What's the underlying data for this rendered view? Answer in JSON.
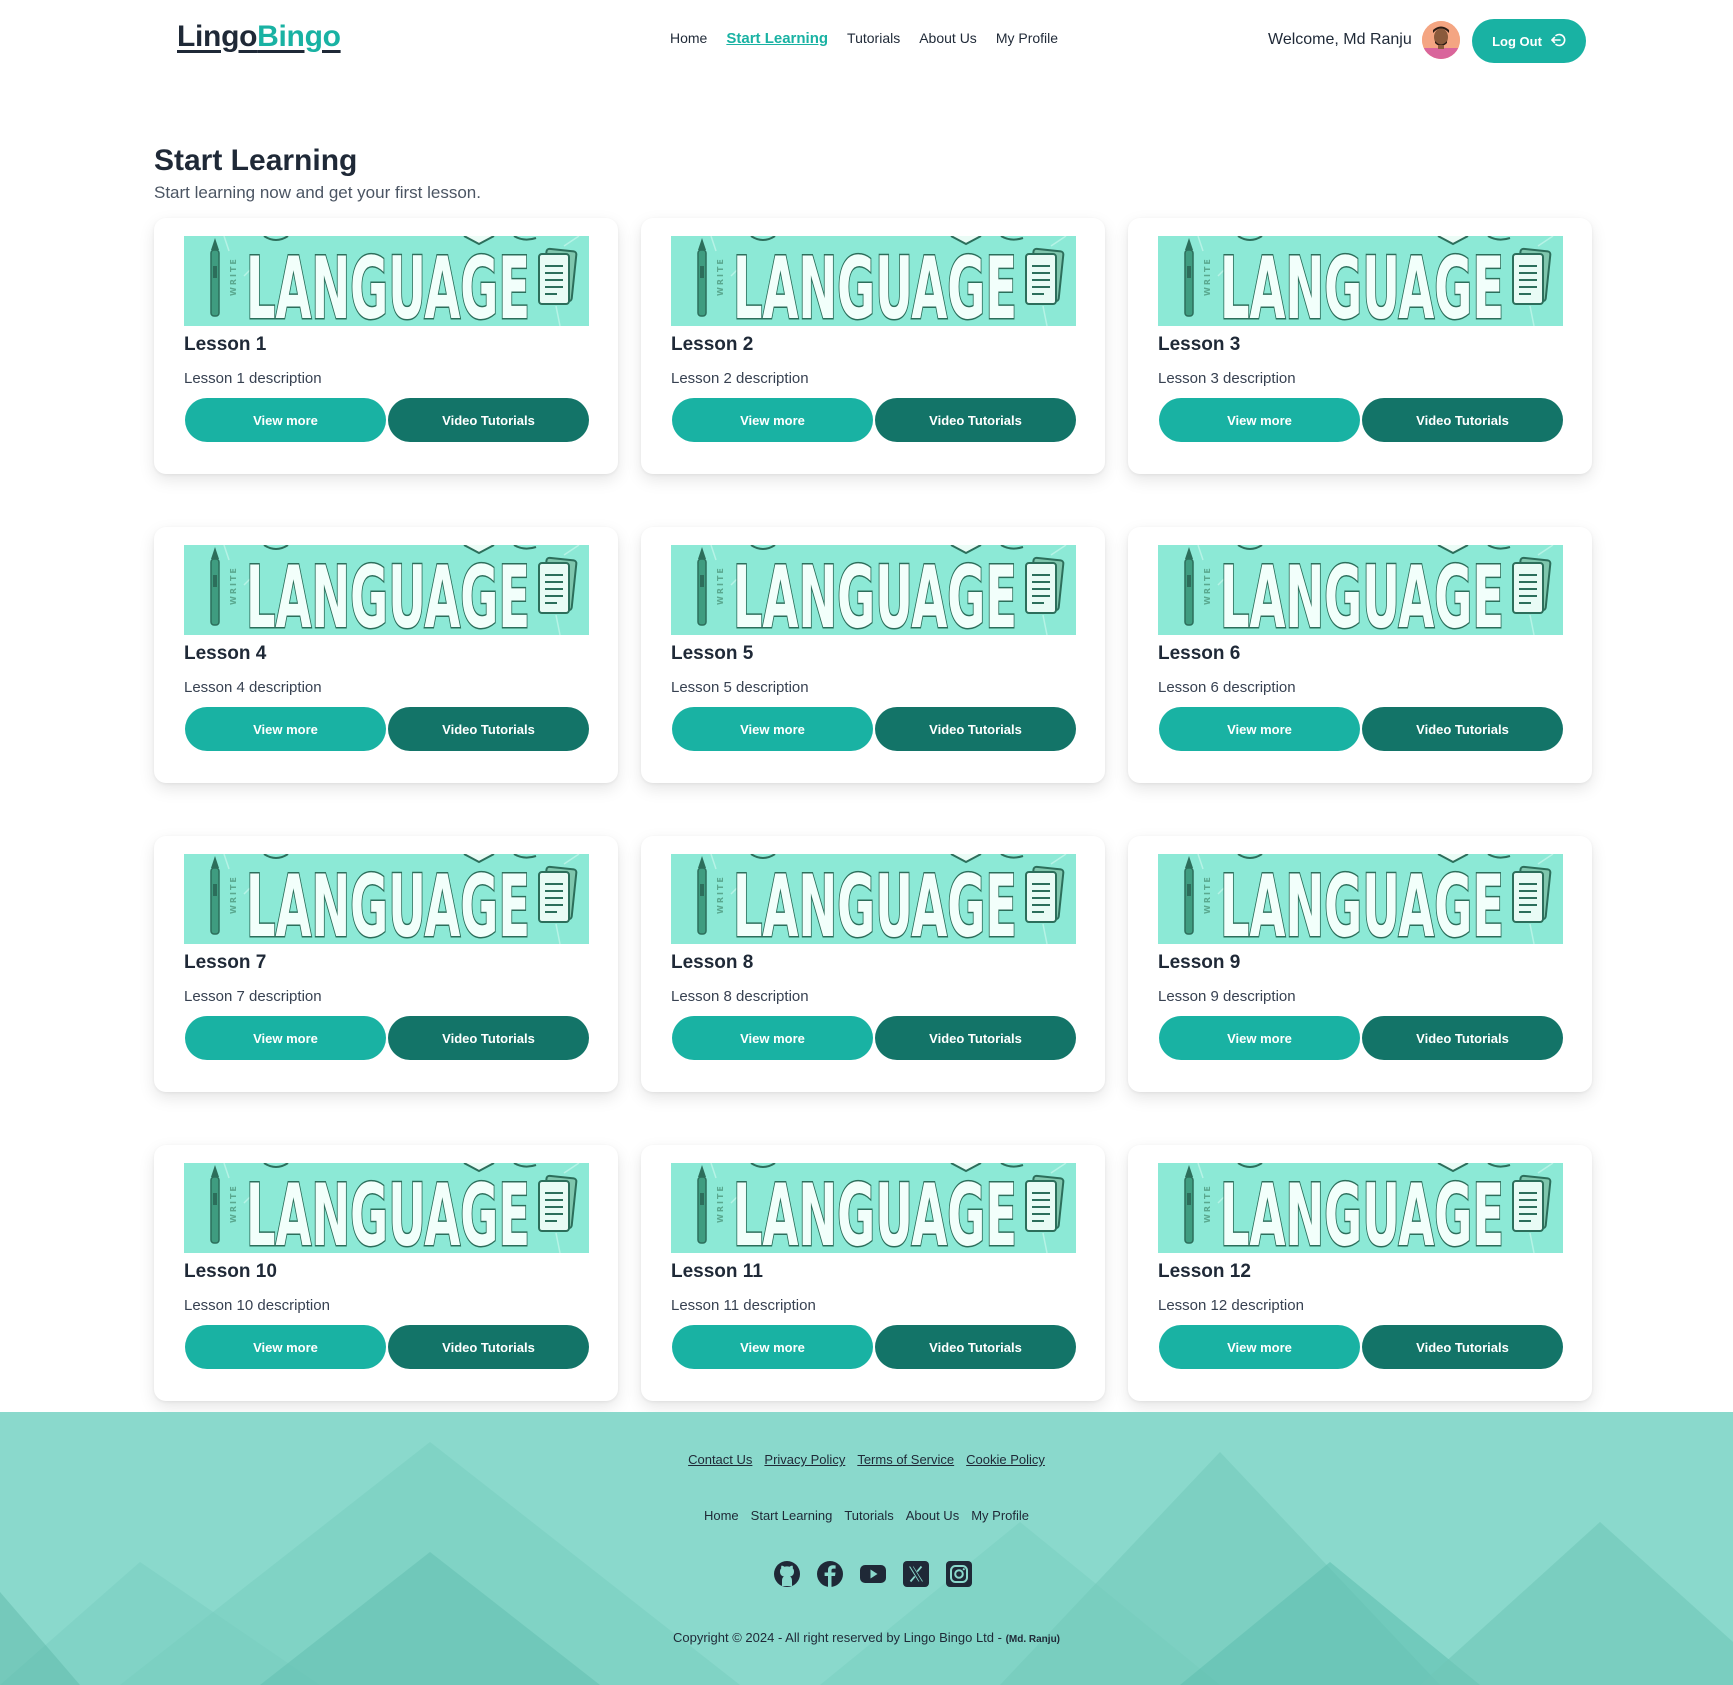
{
  "header": {
    "logo_part1": "Lingo",
    "logo_part2": "Bingo",
    "nav": [
      {
        "label": "Home",
        "active": false
      },
      {
        "label": "Start Learning",
        "active": true
      },
      {
        "label": "Tutorials",
        "active": false
      },
      {
        "label": "About Us",
        "active": false
      },
      {
        "label": "My Profile",
        "active": false
      }
    ],
    "welcome_text": "Welcome, Md Ranju",
    "logout_label": "Log Out"
  },
  "main": {
    "title": "Start Learning",
    "subtitle": "Start learning now and get your first lesson.",
    "banner_text": "LANGUAGE",
    "banner_side_text": "WRITE",
    "lessons": [
      {
        "title": "Lesson 1",
        "description": "Lesson 1 description",
        "view_label": "View more",
        "video_label": "Video Tutorials"
      },
      {
        "title": "Lesson 2",
        "description": "Lesson 2 description",
        "view_label": "View more",
        "video_label": "Video Tutorials"
      },
      {
        "title": "Lesson 3",
        "description": "Lesson 3 description",
        "view_label": "View more",
        "video_label": "Video Tutorials"
      },
      {
        "title": "Lesson 4",
        "description": "Lesson 4 description",
        "view_label": "View more",
        "video_label": "Video Tutorials"
      },
      {
        "title": "Lesson 5",
        "description": "Lesson 5 description",
        "view_label": "View more",
        "video_label": "Video Tutorials"
      },
      {
        "title": "Lesson 6",
        "description": "Lesson 6 description",
        "view_label": "View more",
        "video_label": "Video Tutorials"
      },
      {
        "title": "Lesson 7",
        "description": "Lesson 7 description",
        "view_label": "View more",
        "video_label": "Video Tutorials"
      },
      {
        "title": "Lesson 8",
        "description": "Lesson 8 description",
        "view_label": "View more",
        "video_label": "Video Tutorials"
      },
      {
        "title": "Lesson 9",
        "description": "Lesson 9 description",
        "view_label": "View more",
        "video_label": "Video Tutorials"
      },
      {
        "title": "Lesson 10",
        "description": "Lesson 10 description",
        "view_label": "View more",
        "video_label": "Video Tutorials"
      },
      {
        "title": "Lesson 11",
        "description": "Lesson 11 description",
        "view_label": "View more",
        "video_label": "Video Tutorials"
      },
      {
        "title": "Lesson 12",
        "description": "Lesson 12 description",
        "view_label": "View more",
        "video_label": "Video Tutorials"
      }
    ]
  },
  "footer": {
    "links": [
      "Contact Us",
      "Privacy Policy",
      "Terms of Service",
      "Cookie Policy"
    ],
    "nav": [
      "Home",
      "Start Learning",
      "Tutorials",
      "About Us",
      "My Profile"
    ],
    "social_icons": [
      "github-icon",
      "facebook-icon",
      "youtube-icon",
      "x-icon",
      "instagram-icon"
    ],
    "copyright_main": "Copyright © 2024 - All right reserved by Lingo Bingo Ltd - ",
    "copyright_author": "(Md. Ranju)"
  },
  "colors": {
    "accent": "#19b2a3",
    "accent_dark": "#137468",
    "banner_bg": "#8ce9d6",
    "footer_bg": "#8ad9cc"
  }
}
